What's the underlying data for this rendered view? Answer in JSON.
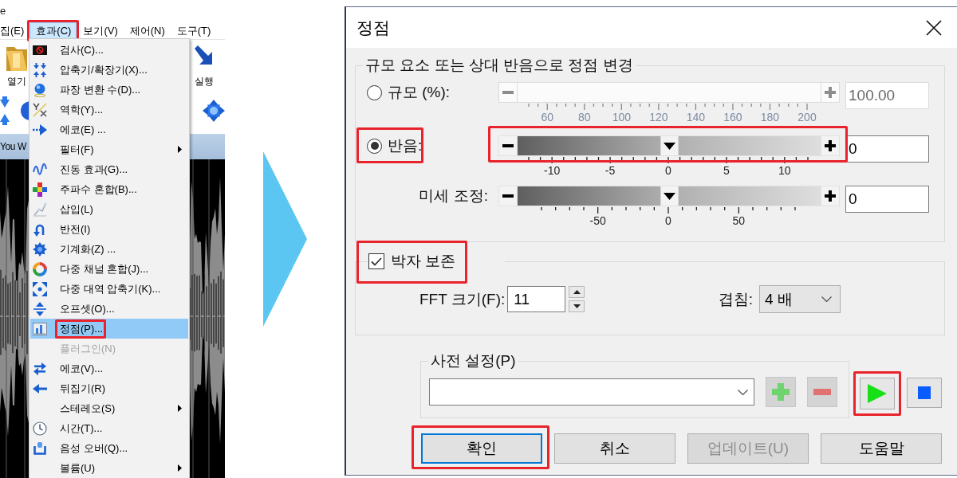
{
  "app": {
    "title_fragment": "e",
    "menubar": [
      {
        "label": "집(E)",
        "selected": false,
        "annotated": false
      },
      {
        "label": "효과(C)",
        "selected": true,
        "annotated": true
      },
      {
        "label": "보기(V)",
        "selected": false,
        "annotated": false
      },
      {
        "label": "제어(N)",
        "selected": false,
        "annotated": false
      },
      {
        "label": "도구(T)",
        "selected": false,
        "annotated": false
      }
    ],
    "toolbar": [
      "열기",
      "실행"
    ],
    "document_title": "You W"
  },
  "effects_menu": [
    {
      "label": "검사(C)...",
      "submenu": false,
      "disabled": false,
      "selected": false,
      "annotated": false
    },
    {
      "label": "압축기/확장기(X)...",
      "submenu": false,
      "disabled": false,
      "selected": false,
      "annotated": false
    },
    {
      "label": "파장 변환 수(D)...",
      "submenu": false,
      "disabled": false,
      "selected": false,
      "annotated": false
    },
    {
      "label": "역학(Y)...",
      "submenu": false,
      "disabled": false,
      "selected": false,
      "annotated": false
    },
    {
      "label": "에코(E) ...",
      "submenu": false,
      "disabled": false,
      "selected": false,
      "annotated": false
    },
    {
      "label": "필터(F)",
      "submenu": true,
      "disabled": false,
      "selected": false,
      "annotated": false
    },
    {
      "label": "진동 효과(G)...",
      "submenu": false,
      "disabled": false,
      "selected": false,
      "annotated": false
    },
    {
      "label": "주파수 혼합(B)...",
      "submenu": false,
      "disabled": false,
      "selected": false,
      "annotated": false
    },
    {
      "label": "삽입(L)",
      "submenu": false,
      "disabled": false,
      "selected": false,
      "annotated": false
    },
    {
      "label": "반전(I)",
      "submenu": false,
      "disabled": false,
      "selected": false,
      "annotated": false
    },
    {
      "label": "기계화(Z) ...",
      "submenu": false,
      "disabled": false,
      "selected": false,
      "annotated": false
    },
    {
      "label": "다중 채널 혼합(J)...",
      "submenu": false,
      "disabled": false,
      "selected": false,
      "annotated": false
    },
    {
      "label": "다중 대역 압축기(K)...",
      "submenu": false,
      "disabled": false,
      "selected": false,
      "annotated": false
    },
    {
      "label": "오프셋(O)...",
      "submenu": false,
      "disabled": false,
      "selected": false,
      "annotated": false
    },
    {
      "label": "정점(P)...",
      "submenu": false,
      "disabled": false,
      "selected": true,
      "annotated": true
    },
    {
      "label": "플러그인(N)",
      "submenu": false,
      "disabled": true,
      "selected": false,
      "annotated": false
    },
    {
      "label": "에코(V)...",
      "submenu": false,
      "disabled": false,
      "selected": false,
      "annotated": false
    },
    {
      "label": "뒤집기(R)",
      "submenu": false,
      "disabled": false,
      "selected": false,
      "annotated": false
    },
    {
      "label": "스테레오(S)",
      "submenu": true,
      "disabled": false,
      "selected": false,
      "annotated": false
    },
    {
      "label": "시간(T)...",
      "submenu": false,
      "disabled": false,
      "selected": false,
      "annotated": false
    },
    {
      "label": "음성 오버(Q)...",
      "submenu": false,
      "disabled": false,
      "selected": false,
      "annotated": false
    },
    {
      "label": "볼륨(U)",
      "submenu": true,
      "disabled": false,
      "selected": false,
      "annotated": false
    }
  ],
  "dialog": {
    "title": "정점",
    "pitch_group": {
      "legend": "규모 요소 또는 상대 반음으로 정점 변경",
      "rows": [
        {
          "kind": "radio",
          "label": "규모 (%):",
          "selected": false,
          "annotated": false,
          "disabled": true,
          "slider_annotated": false,
          "ticks": [
            "60",
            "80",
            "100",
            "120",
            "140",
            "160",
            "180",
            "200"
          ],
          "value": "100.00"
        },
        {
          "kind": "radio",
          "label": "반음:",
          "selected": true,
          "annotated": true,
          "disabled": false,
          "slider_annotated": true,
          "level": 0.5,
          "ticks": [
            "-10",
            "-5",
            "0",
            "5",
            "10"
          ],
          "value": "0"
        },
        {
          "kind": "plain",
          "label": "미세 조정:",
          "disabled": false,
          "slider_annotated": false,
          "level": 0.5,
          "ticks": [
            "-50",
            "0",
            "50"
          ],
          "value": "0"
        }
      ]
    },
    "beat_group": {
      "checkbox": {
        "label": "박자 보존",
        "checked": true,
        "annotated": true
      },
      "fft_size": {
        "label": "FFT 크기(F):",
        "value": "11"
      },
      "overlap": {
        "label": "겹침:",
        "value": "4 배"
      }
    },
    "presets": {
      "legend": "사전 설정(P)",
      "tools": [
        {
          "kind": "add",
          "disabled": true,
          "annotated": false
        },
        {
          "kind": "remove",
          "disabled": true,
          "annotated": false
        }
      ]
    },
    "playback": [
      {
        "kind": "play",
        "disabled": false,
        "annotated": true
      },
      {
        "kind": "stop",
        "disabled": false,
        "annotated": false
      }
    ],
    "buttons": [
      {
        "label": "확인",
        "focused": true,
        "disabled": false,
        "annotated": true
      },
      {
        "label": "취소",
        "focused": false,
        "disabled": false,
        "annotated": false
      },
      {
        "label": "업데이트(U)",
        "focused": false,
        "disabled": true,
        "annotated": false
      },
      {
        "label": "도움말",
        "focused": false,
        "disabled": false,
        "annotated": false
      }
    ]
  }
}
